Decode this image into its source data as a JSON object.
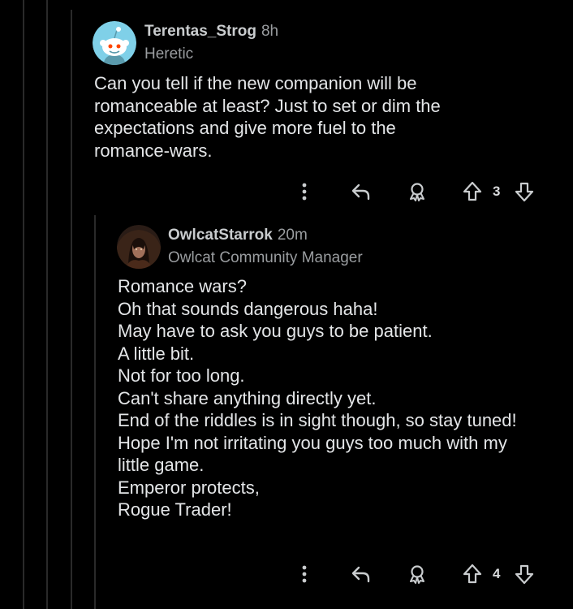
{
  "colors": {
    "background": "#000000",
    "thread_line": "#2a2a2a",
    "text": "#e4e6e8",
    "muted": "#9a9da0",
    "icon": "#c9ccce",
    "snoo_avatar_bg": "#7fd0e8"
  },
  "comments": [
    {
      "author": "Terentas_Strog",
      "time": "8h",
      "flair": "Heretic",
      "avatar_icon": "snoo-avatar-icon",
      "body": [
        "Can you tell if the new companion will be",
        "romanceable at least? Just to set or dim the",
        "expectations and give more fuel to the",
        "romance-wars."
      ],
      "votes": "3",
      "action_icons": [
        "more-icon",
        "reply-icon",
        "award-icon",
        "upvote-icon",
        "downvote-icon"
      ]
    },
    {
      "author": "OwlcatStarrok",
      "time": "20m",
      "flair": "Owlcat Community Manager",
      "avatar_icon": "character-portrait-avatar",
      "body": [
        "Romance wars?",
        "Oh that sounds dangerous haha!",
        "May have to ask you guys to be patient.",
        "A little bit.",
        "Not for too long.",
        "Can't share anything directly yet.",
        "End of the riddles is in sight though, so stay tuned!",
        "",
        "Hope I'm not irritating you guys too much with my",
        "little game.",
        "Emperor protects,",
        "Rogue Trader!"
      ],
      "votes": "4",
      "action_icons": [
        "more-icon",
        "reply-icon",
        "award-icon",
        "upvote-icon",
        "downvote-icon"
      ]
    }
  ]
}
